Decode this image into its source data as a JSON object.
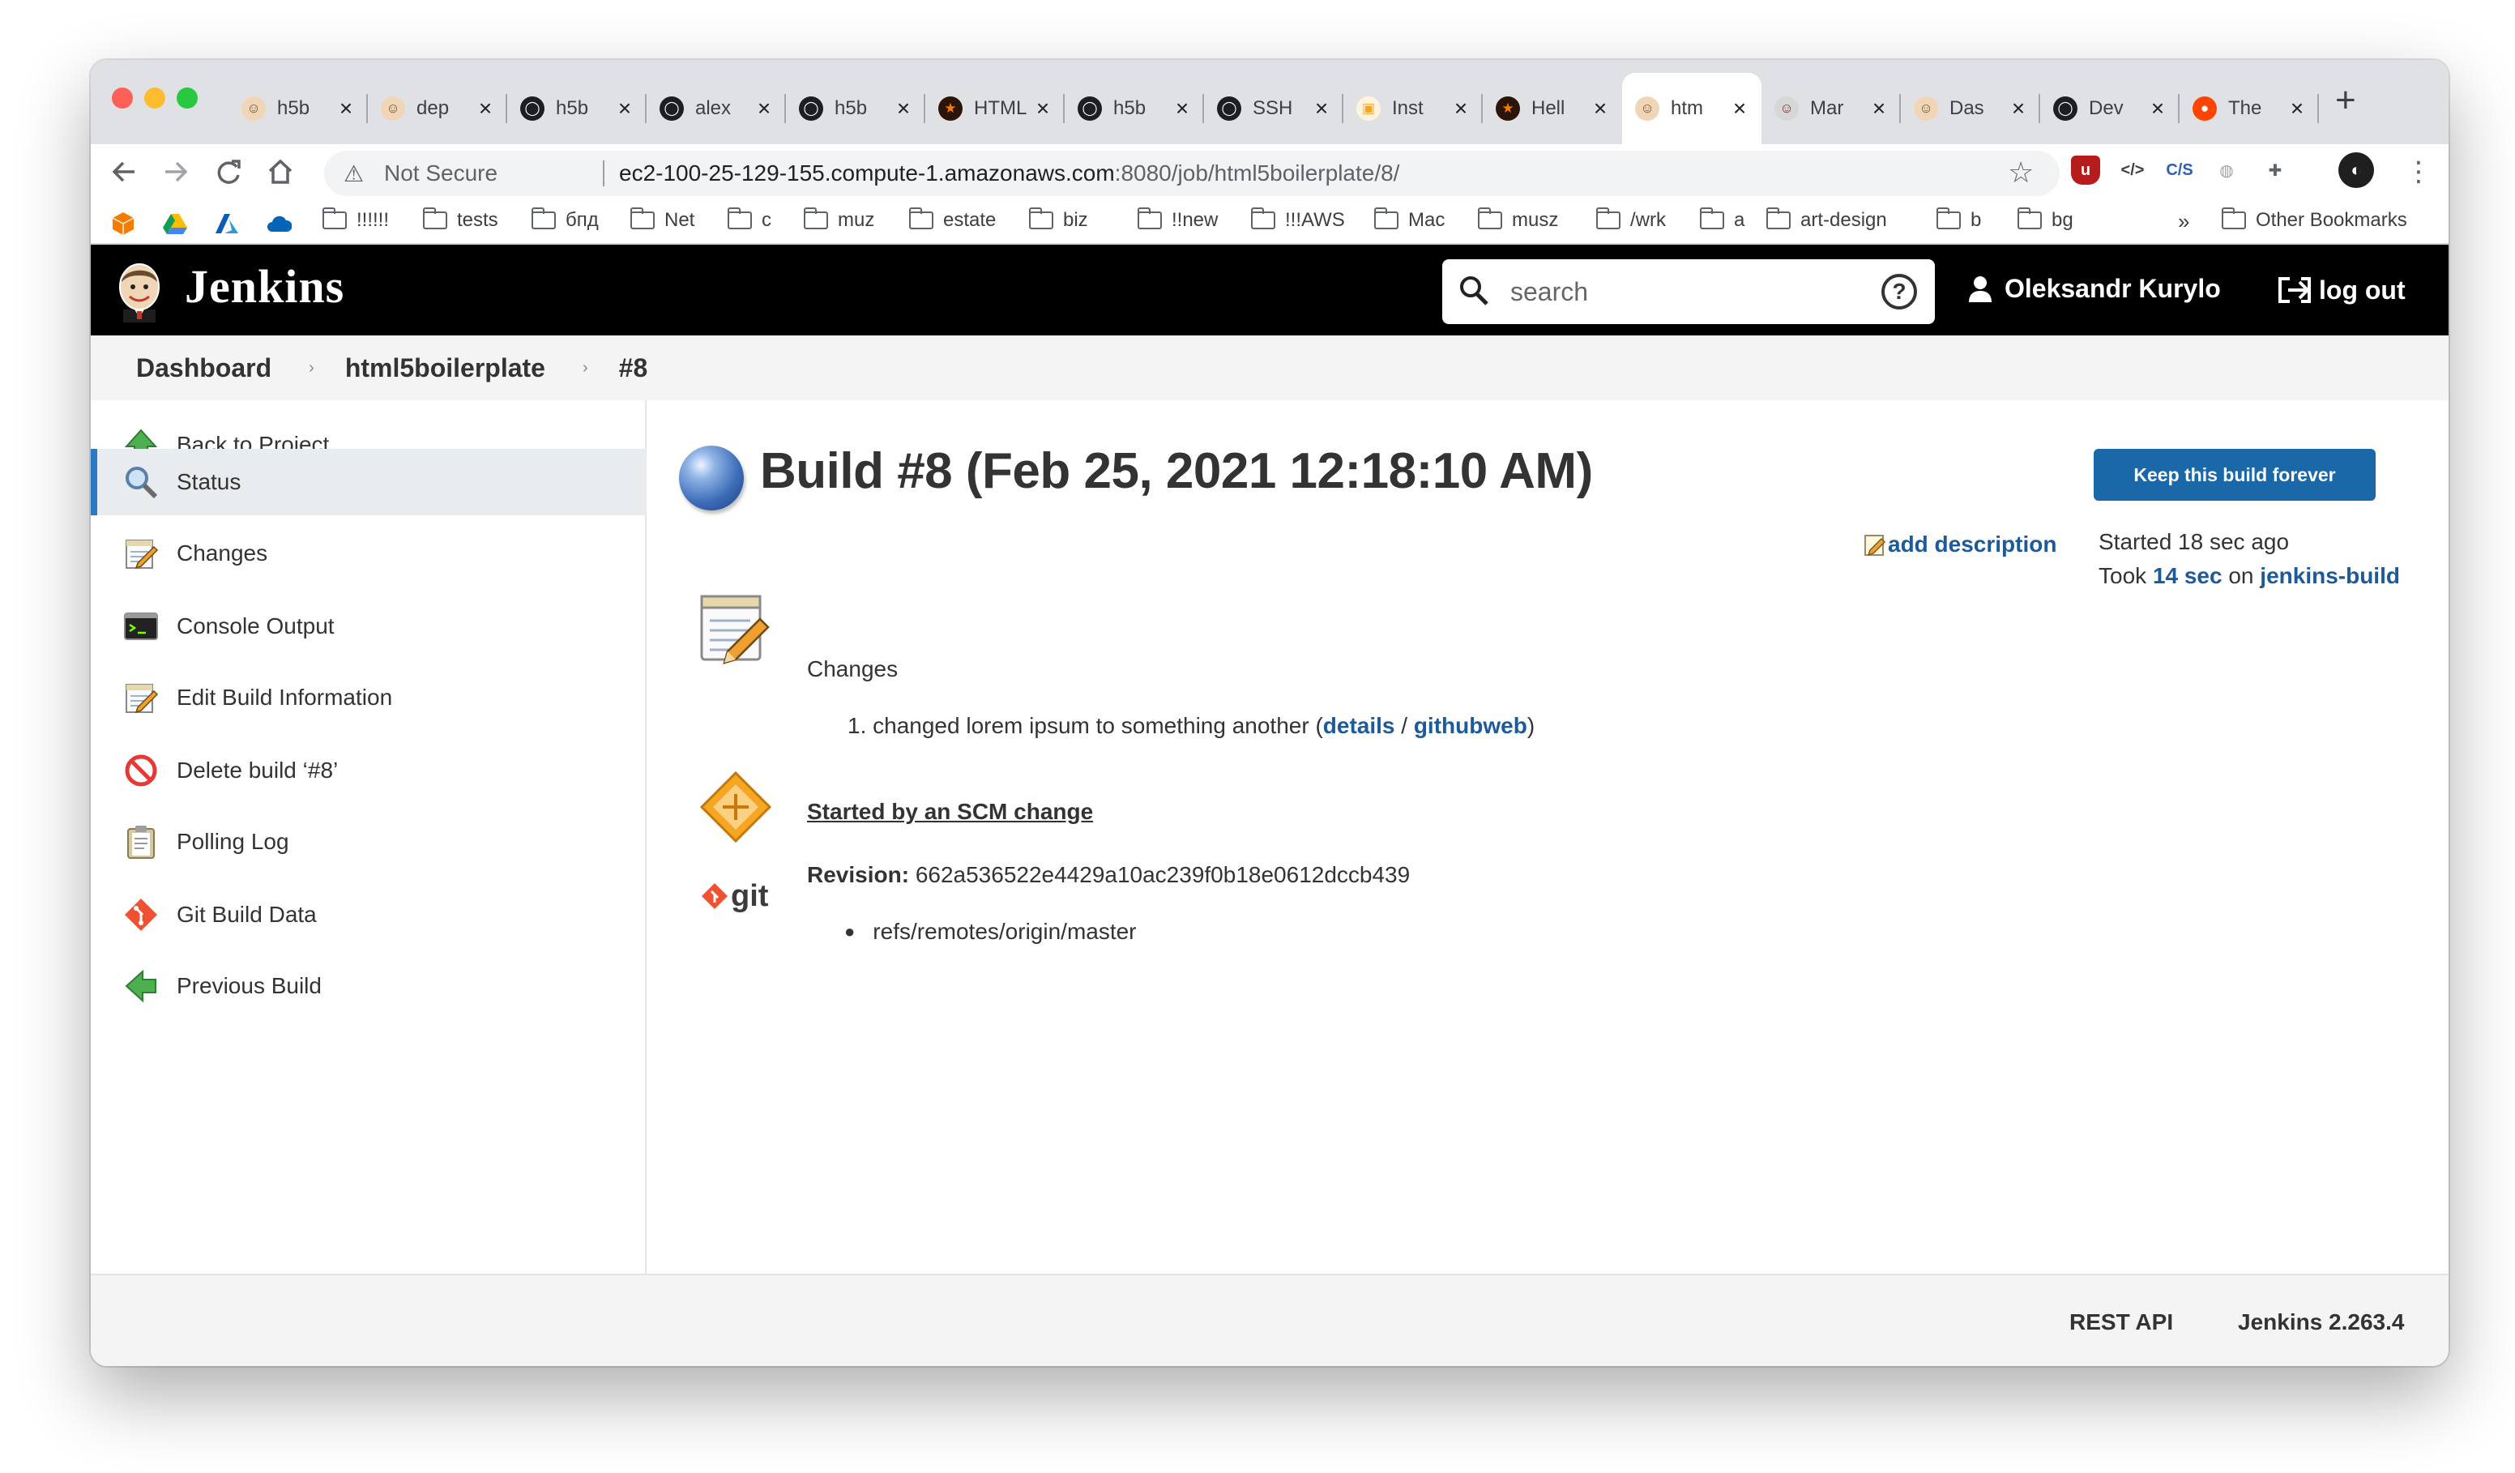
{
  "browser": {
    "tabs": [
      {
        "label": "h5b",
        "icon": "jenkins-icon"
      },
      {
        "label": "dep",
        "icon": "jenkins-icon"
      },
      {
        "label": "h5b",
        "icon": "github-icon"
      },
      {
        "label": "alex",
        "icon": "github-icon"
      },
      {
        "label": "h5b",
        "icon": "github-icon"
      },
      {
        "label": "HTML",
        "icon": "star-icon"
      },
      {
        "label": "h5b",
        "icon": "github-icon"
      },
      {
        "label": "SSH",
        "icon": "github-icon"
      },
      {
        "label": "Inst",
        "icon": "box-icon"
      },
      {
        "label": "Hell",
        "icon": "star-icon"
      },
      {
        "label": "htm",
        "icon": "jenkins-icon",
        "active": true
      },
      {
        "label": "Mar",
        "icon": "devil-icon"
      },
      {
        "label": "Das",
        "icon": "jenkins-icon"
      },
      {
        "label": "Dev",
        "icon": "github-icon"
      },
      {
        "label": "The",
        "icon": "reddit-icon"
      }
    ],
    "address": {
      "security_label": "Not Secure",
      "url_host": "ec2-100-25-129-155.compute-1.amazonaws.com",
      "url_rest": ":8080/job/html5boilerplate/8/"
    },
    "extensions": [
      {
        "name": "ublock-icon",
        "glyph": "u",
        "color": "#b71c1c"
      },
      {
        "name": "code-icon",
        "glyph": "</>",
        "color": "#3c4043"
      },
      {
        "name": "css-icon",
        "glyph": "C/S",
        "color": "#2b5fb3"
      },
      {
        "name": "globe-icon",
        "glyph": "◍",
        "color": "#9aa0a6"
      },
      {
        "name": "puzzle-icon",
        "glyph": "✚",
        "color": "#5f6368"
      }
    ],
    "bookmarks": [
      {
        "label": "!!!!!!",
        "folder": true
      },
      {
        "label": "tests",
        "folder": true
      },
      {
        "label": "бпд",
        "folder": true
      },
      {
        "label": "Net",
        "folder": true
      },
      {
        "label": "c",
        "folder": true
      },
      {
        "label": "muz",
        "folder": true
      },
      {
        "label": "estate",
        "folder": true
      },
      {
        "label": "biz",
        "folder": true
      },
      {
        "label": "!!new",
        "folder": true
      },
      {
        "label": "!!!AWS",
        "folder": true
      },
      {
        "label": "Mac",
        "folder": true
      },
      {
        "label": "musz",
        "folder": true
      },
      {
        "label": "/wrk",
        "folder": true
      },
      {
        "label": "a",
        "folder": true
      },
      {
        "label": "art-design",
        "folder": true
      },
      {
        "label": "b",
        "folder": true
      },
      {
        "label": "bg",
        "folder": true
      }
    ],
    "bookmarks_overflow": "»",
    "other_bookmarks": "Other Bookmarks"
  },
  "jenkins": {
    "title": "Jenkins",
    "search_placeholder": "search",
    "help_glyph": "?",
    "user_name": "Oleksandr Kurylo",
    "logout_label": "log out"
  },
  "breadcrumb": [
    "Dashboard",
    "html5boilerplate",
    "#8"
  ],
  "sidebar": [
    {
      "label": "Back to Project",
      "icon": "up-arrow-icon"
    },
    {
      "label": "Status",
      "icon": "magnifier-icon",
      "active": true
    },
    {
      "label": "Changes",
      "icon": "notepad-icon"
    },
    {
      "label": "Console Output",
      "icon": "terminal-icon"
    },
    {
      "label": "Edit Build Information",
      "icon": "notepad-icon"
    },
    {
      "label": "Delete build ‘#8’",
      "icon": "no-entry-icon"
    },
    {
      "label": "Polling Log",
      "icon": "clipboard-icon"
    },
    {
      "label": "Git Build Data",
      "icon": "git-icon"
    },
    {
      "label": "Previous Build",
      "icon": "left-arrow-icon"
    }
  ],
  "build": {
    "title": "Build #8 (Feb 25, 2021 12:18:10 AM)",
    "status_color": "blue",
    "keep_button": "Keep this build forever",
    "add_description": "add description",
    "started": "Started 18 sec ago",
    "took_prefix": "Took",
    "took_duration": "14 sec",
    "took_on": "on",
    "took_node": "jenkins-build",
    "changes_heading": "Changes",
    "change_number": "1.",
    "change_text": "changed lorem ipsum to something another (",
    "change_details": "details",
    "change_sep": " / ",
    "change_githubweb": "githubweb",
    "change_close": ")",
    "cause": "Started by an SCM change",
    "revision_label": "Revision:",
    "revision_hash": "662a536522e4429a10ac239f0b18e0612dccb439",
    "branch": "refs/remotes/origin/master"
  },
  "footer": {
    "rest_api": "REST API",
    "version": "Jenkins 2.263.4"
  }
}
